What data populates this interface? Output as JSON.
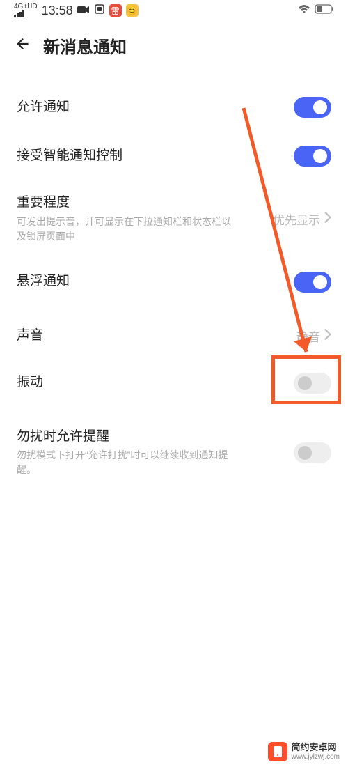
{
  "statusBar": {
    "networkLabel": "4G+HD",
    "time": "13:58"
  },
  "header": {
    "title": "新消息通知"
  },
  "settings": {
    "allowNotifications": {
      "label": "允许通知",
      "on": true
    },
    "smartControl": {
      "label": "接受智能通知控制",
      "on": true
    },
    "importance": {
      "label": "重要程度",
      "desc": "可发出提示音，并可显示在下拉通知栏和状态栏以及锁屏页面中",
      "value": "优先显示"
    },
    "floating": {
      "label": "悬浮通知",
      "on": true
    },
    "sound": {
      "label": "声音",
      "value": "静音"
    },
    "vibration": {
      "label": "振动",
      "on": false
    },
    "dnd": {
      "label": "勿扰时允许提醒",
      "desc": "勿扰模式下打开“允许打扰”时可以继续收到通知提醒。",
      "on": false
    }
  },
  "watermark": {
    "title": "简约安卓网",
    "url": "www.jylzwj.com"
  }
}
